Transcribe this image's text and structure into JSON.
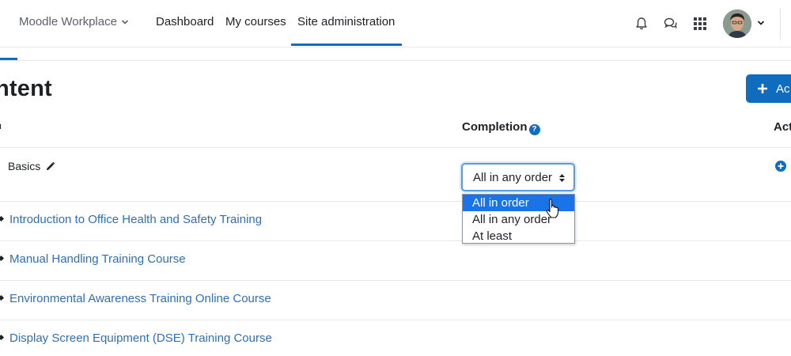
{
  "navbar": {
    "brand": "Moodle Workplace",
    "links": [
      "Dashboard",
      "My courses",
      "Site administration"
    ],
    "active_link": "Site administration",
    "icons": [
      "bell-icon",
      "chat-icon",
      "apps-grid-icon"
    ]
  },
  "page": {
    "title": "ntent",
    "add_button_label": "Ac"
  },
  "table": {
    "headers": {
      "completion": "Completion",
      "actions": "Act"
    },
    "section": {
      "name": "Basics"
    },
    "completion_select": {
      "value": "All in any order",
      "options": [
        "All in order",
        "All in any order",
        "At least"
      ],
      "highlighted": "All in order"
    },
    "courses": [
      "Introduction to Office Health and Safety Training",
      "Manual Handling Training Course",
      "Environmental Awareness Training Online Course",
      "Display Screen Equipment (DSE) Training Course"
    ]
  },
  "colors": {
    "primary": "#0f6cbf",
    "link": "#2f6fb5",
    "option_highlight": "#1a73e8"
  }
}
